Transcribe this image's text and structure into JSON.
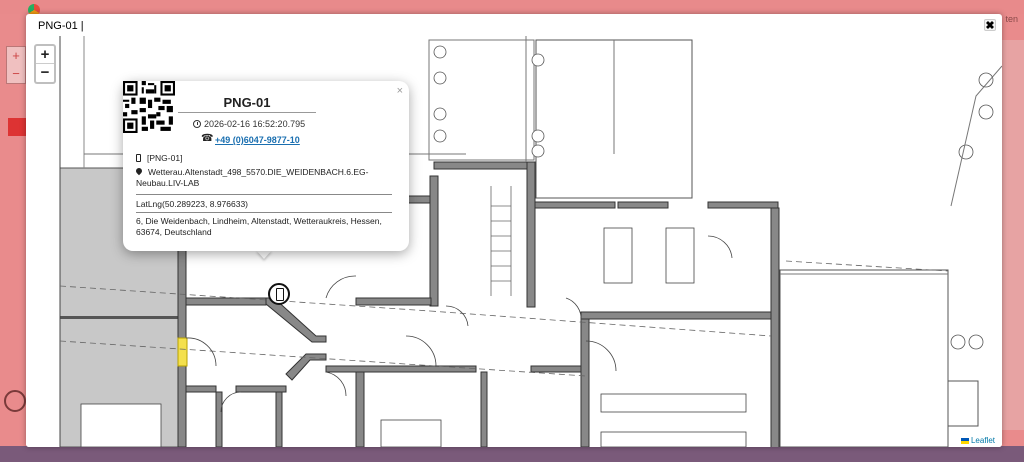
{
  "modal": {
    "title": "PNG-01 |",
    "close_label": "✖"
  },
  "map": {
    "zoom_in": "+",
    "zoom_out": "−",
    "attribution": "Leaflet"
  },
  "background": {
    "right_text": "ten",
    "zoom_in": "+",
    "zoom_out": "−"
  },
  "popup": {
    "close": "×",
    "device_name": "PNG-01",
    "timestamp": "2026-02-16 16:52:20.795",
    "phone": "+49 (0)6047-9877-10",
    "device_id": "[PNG-01]",
    "location": "Wetterau.Altenstadt_498_5570.DIE_WEIDENBACH.6.EG-Neubau.LIV-LAB",
    "latlng": "LatLng(50.289223, 8.976633)",
    "address": "6, Die Weidenbach, Lindheim, Altenstadt, Wetteraukreis, Hessen, 63674, Deutschland"
  },
  "icons": {
    "device": "mobile-phone-icon",
    "clock": "clock-icon",
    "call": "phone-icon",
    "id": "mobile-small-icon",
    "location": "map-pin-icon",
    "qr": "qr-code",
    "marker": "device-marker-icon"
  }
}
